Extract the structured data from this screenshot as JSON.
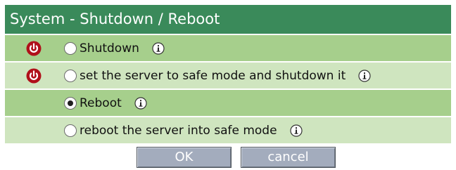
{
  "header": {
    "title": "System - Shutdown / Reboot"
  },
  "options": [
    {
      "label": "Shutdown",
      "checked": false,
      "power_icon": true,
      "icon": "power-icon"
    },
    {
      "label": "set the server to safe mode and shutdown it",
      "checked": false,
      "power_icon": true,
      "icon": "power-icon"
    },
    {
      "label": "Reboot",
      "checked": true,
      "power_icon": false
    },
    {
      "label": "reboot the server into safe mode",
      "checked": false,
      "power_icon": false
    }
  ],
  "buttons": {
    "ok_label": "OK",
    "cancel_label": "cancel"
  },
  "colors": {
    "title_bg": "#3a8a5a",
    "row_dark": "#a6cf8c",
    "row_light": "#cfe5bf",
    "power_icon": "#b0101a",
    "button_bg": "#a3acbd"
  }
}
